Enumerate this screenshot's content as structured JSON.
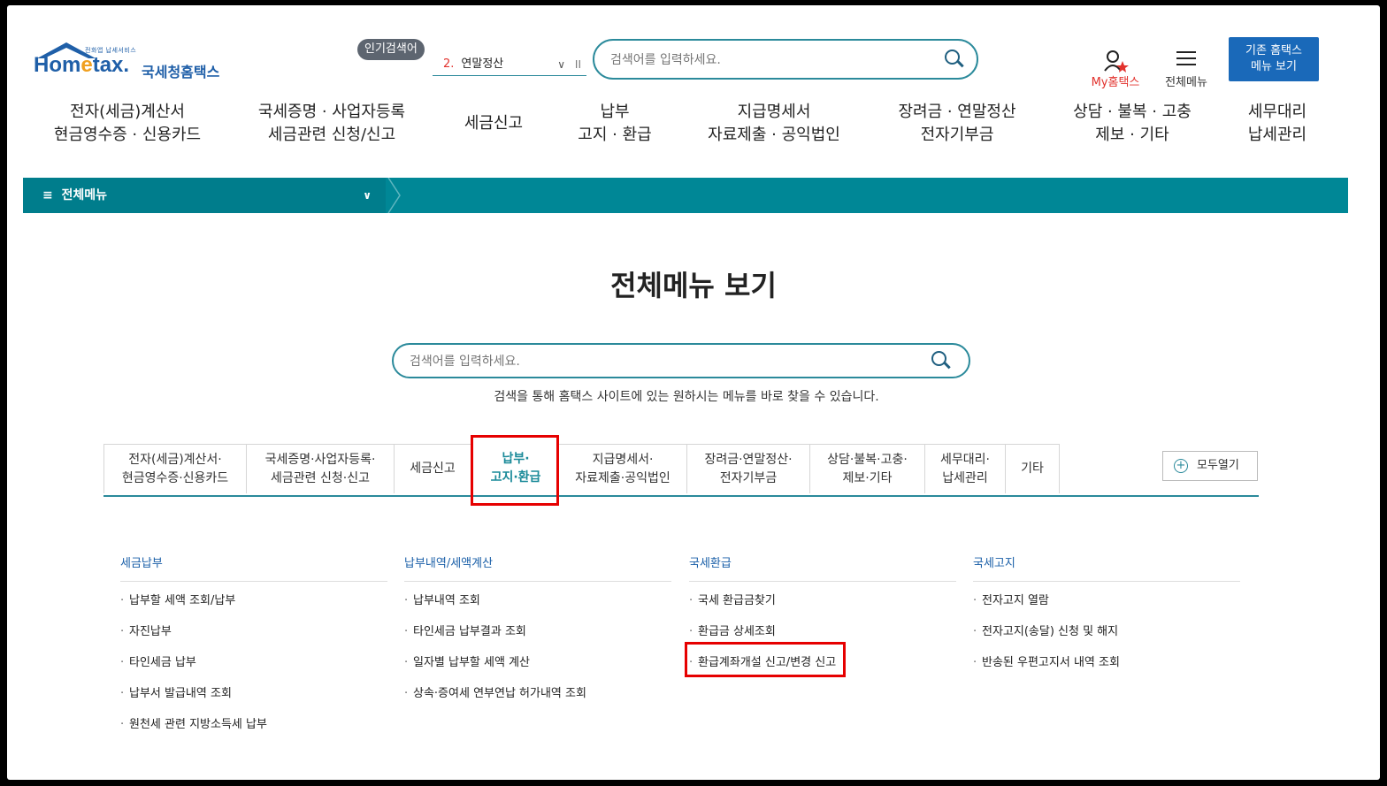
{
  "header": {
    "logo_small": "전화앱 납세서비스",
    "logo_main_a": "Hom",
    "logo_main_b": "e",
    "logo_main_c": "tax.",
    "logo_sub": "국세청홈택스",
    "popular_label": "인기검색어",
    "popular_rank": "2.",
    "popular_value": "연말정산",
    "search_placeholder": "검색어를 입력하세요.",
    "my_home_label": "My홈택스",
    "all_menu_label": "전체메뉴",
    "old_menu_line1": "기존 홈택스",
    "old_menu_line2": "메뉴 보기"
  },
  "gnb": [
    {
      "line1": "전자(세금)계산서",
      "line2": "현금영수증 · 신용카드"
    },
    {
      "line1": "국세증명 · 사업자등록",
      "line2": "세금관련 신청/신고"
    },
    {
      "line1": "세금신고",
      "line2": ""
    },
    {
      "line1": "납부",
      "line2": "고지 · 환급"
    },
    {
      "line1": "지급명세서",
      "line2": "자료제출 · 공익법인"
    },
    {
      "line1": "장려금 · 연말정산",
      "line2": "전자기부금"
    },
    {
      "line1": "상담 · 불복 · 고충",
      "line2": "제보 · 기타"
    },
    {
      "line1": "세무대리",
      "line2": "납세관리"
    }
  ],
  "bar": {
    "label": "전체메뉴"
  },
  "main": {
    "title": "전체메뉴 보기",
    "search_placeholder": "검색어를 입력하세요.",
    "search_help": "검색을 통해 홈택스 사이트에 있는 원하시는 메뉴를 바로 찾을 수 있습니다.",
    "open_all": "모두열기"
  },
  "tabs": [
    {
      "line1": "전자(세금)계산서·",
      "line2": "현금영수증·신용카드"
    },
    {
      "line1": "국세증명·사업자등록·",
      "line2": "세금관련 신청·신고"
    },
    {
      "line1": "세금신고",
      "line2": ""
    },
    {
      "line1": "납부·",
      "line2": "고지·환급"
    },
    {
      "line1": "지급명세서·",
      "line2": "자료제출·공익법인"
    },
    {
      "line1": "장려금·연말정산·",
      "line2": "전자기부금"
    },
    {
      "line1": "상담·불복·고충·",
      "line2": "제보·기타"
    },
    {
      "line1": "세무대리·",
      "line2": "납세관리"
    },
    {
      "line1": "기타",
      "line2": ""
    }
  ],
  "columns": [
    {
      "title": "세금납부",
      "items": [
        "납부할 세액 조회/납부",
        "자진납부",
        "타인세금 납부",
        "납부서 발급내역 조회",
        "원천세 관련 지방소득세 납부"
      ]
    },
    {
      "title": "납부내역/세액계산",
      "items": [
        "납부내역 조회",
        "타인세금 납부결과 조회",
        "일자별 납부할 세액 계산",
        "상속·증여세 연부연납 허가내역 조회"
      ]
    },
    {
      "title": "국세환급",
      "items": [
        "국세 환급금찾기",
        "환급금 상세조회",
        "환급계좌개설 신고/변경 신고"
      ]
    },
    {
      "title": "국세고지",
      "items": [
        "전자고지 열람",
        "전자고지(송달) 신청 및 해지",
        "반송된 우편고지서 내역 조회"
      ]
    }
  ]
}
